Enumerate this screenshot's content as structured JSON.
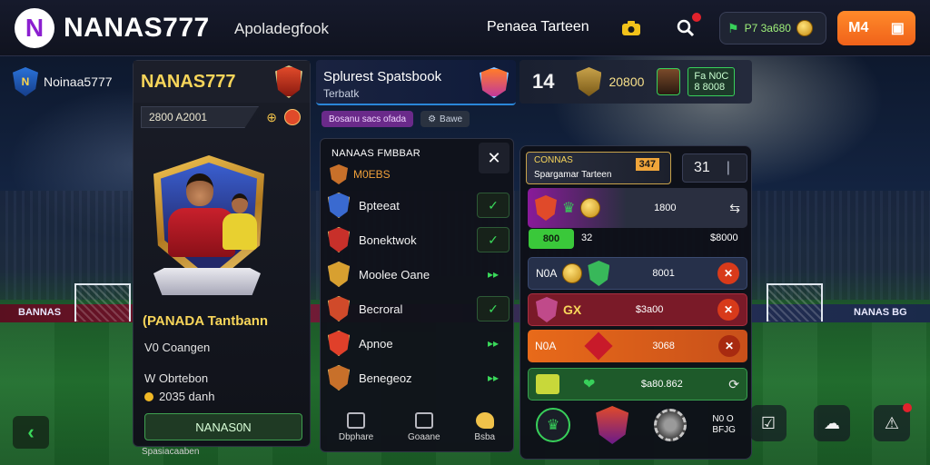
{
  "topbar": {
    "logo_letter": "N",
    "brand": "NANAS777",
    "sub_brand": "Apoladegfook",
    "link": "Penaea Tarteen",
    "wallet_amount": "P7 3a680",
    "deposit_label": "M4"
  },
  "left_user": {
    "name": "Noinaa5777"
  },
  "profile": {
    "name": "NANAS777",
    "balance": "2800 A2001",
    "title": "(PANADA Tantbann",
    "line1": "V0 Coangen",
    "line2": "W Obrtebon",
    "line3": "2035 danh",
    "button": "NANAS0N",
    "footer": "Spasiacaaben"
  },
  "sportsbook": {
    "title": "Splurest Spatsbook",
    "subtitle": "Terbatk",
    "chips": [
      "Bosanu sacs ofada",
      "Bawe"
    ]
  },
  "stats": {
    "number": "14",
    "score": "20800",
    "tag_line1": "Fa N0C",
    "tag_line2": "8 8008"
  },
  "menu": {
    "title": "NANAAS FMBBAR",
    "sub": "M0EBS",
    "items": [
      {
        "label": "Bpteeat",
        "control": "check",
        "color": "#3a6ad0"
      },
      {
        "label": "Bonektwok",
        "control": "check",
        "color": "#c8302a"
      },
      {
        "label": "Moolee Oane",
        "control": "arrows",
        "color": "#d8a030"
      },
      {
        "label": "Becroral",
        "control": "check",
        "color": "#d04a2a"
      },
      {
        "label": "Apnoe",
        "control": "arrows",
        "color": "#e0402a"
      },
      {
        "label": "Benegeoz",
        "control": "arrows",
        "color": "#c8702a"
      }
    ],
    "tabs": [
      {
        "label": "Dbphare",
        "icon": "image-icon"
      },
      {
        "label": "Goaane",
        "icon": "copy-icon"
      },
      {
        "label": "Bsba",
        "icon": "whistle-icon"
      }
    ]
  },
  "match": {
    "header_title": "CONNAS",
    "header_sub": "Spargamar Tarteen",
    "header_highlight": "347",
    "count": "31",
    "rows": [
      {
        "label": "",
        "value": "1800",
        "value2": "$8000",
        "bg": "#5a1a6a"
      },
      {
        "label": "N0A",
        "value": "8001",
        "bg": "#26304a"
      },
      {
        "label": "GX",
        "value": "$3a00",
        "bg": "#7a1a28"
      },
      {
        "label": "N0A",
        "value": "3068",
        "bg": "#e06a1a"
      },
      {
        "label": "",
        "value": "$a80.862",
        "bg": "#1e5a2a"
      }
    ],
    "pill": "800",
    "pill_value": "32",
    "bottom_text_1": "N0 O",
    "bottom_text_2": "BFJG"
  }
}
